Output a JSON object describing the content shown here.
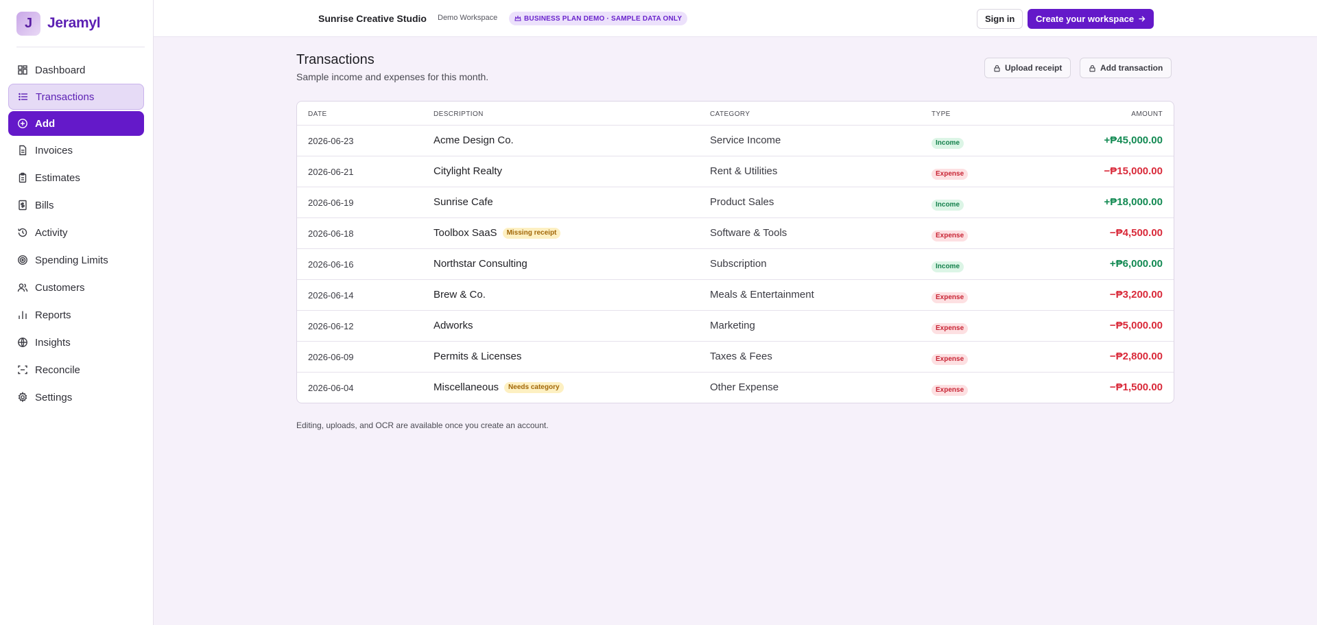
{
  "brand": {
    "logo_letter": "J",
    "name": "Jeramyl"
  },
  "sidebar": {
    "items": [
      {
        "label": "Dashboard",
        "icon": "grid-icon"
      },
      {
        "label": "Transactions",
        "icon": "list-icon",
        "active": true
      },
      {
        "label": "Add",
        "icon": "plus-circle-icon"
      },
      {
        "label": "Invoices",
        "icon": "file-text-icon"
      },
      {
        "label": "Estimates",
        "icon": "clipboard-icon"
      },
      {
        "label": "Bills",
        "icon": "bill-icon"
      },
      {
        "label": "Activity",
        "icon": "history-icon"
      },
      {
        "label": "Spending Limits",
        "icon": "target-icon"
      },
      {
        "label": "Customers",
        "icon": "users-icon"
      },
      {
        "label": "Reports",
        "icon": "bar-chart-icon"
      },
      {
        "label": "Insights",
        "icon": "globe-icon"
      },
      {
        "label": "Reconcile",
        "icon": "scan-icon"
      },
      {
        "label": "Settings",
        "icon": "gear-icon"
      }
    ]
  },
  "header": {
    "workspace_name": "Sunrise Creative Studio",
    "workspace_sub": "Demo Workspace",
    "plan_badge": "BUSINESS PLAN DEMO · SAMPLE DATA ONLY",
    "sign_in": "Sign in",
    "create_workspace": "Create your workspace"
  },
  "main": {
    "title": "Transactions",
    "subtitle": "Sample income and expenses for this month.",
    "upload_receipt": "Upload receipt",
    "add_transaction": "Add transaction",
    "footnote": "Editing, uploads, and OCR are available once you create an account."
  },
  "table": {
    "headers": {
      "date": "Date",
      "description": "Description",
      "category": "Category",
      "type": "Type",
      "amount": "Amount"
    },
    "rows": [
      {
        "date": "2026-06-23",
        "description": "Acme Design Co.",
        "tag": "",
        "category": "Service Income",
        "type": "Income",
        "amount": "+₱45,000.00"
      },
      {
        "date": "2026-06-21",
        "description": "Citylight Realty",
        "tag": "",
        "category": "Rent & Utilities",
        "type": "Expense",
        "amount": "−₱15,000.00"
      },
      {
        "date": "2026-06-19",
        "description": "Sunrise Cafe",
        "tag": "",
        "category": "Product Sales",
        "type": "Income",
        "amount": "+₱18,000.00"
      },
      {
        "date": "2026-06-18",
        "description": "Toolbox SaaS",
        "tag": "Missing receipt",
        "category": "Software & Tools",
        "type": "Expense",
        "amount": "−₱4,500.00"
      },
      {
        "date": "2026-06-16",
        "description": "Northstar Consulting",
        "tag": "",
        "category": "Subscription",
        "type": "Income",
        "amount": "+₱6,000.00"
      },
      {
        "date": "2026-06-14",
        "description": "Brew & Co.",
        "tag": "",
        "category": "Meals & Entertainment",
        "type": "Expense",
        "amount": "−₱3,200.00"
      },
      {
        "date": "2026-06-12",
        "description": "Adworks",
        "tag": "",
        "category": "Marketing",
        "type": "Expense",
        "amount": "−₱5,000.00"
      },
      {
        "date": "2026-06-09",
        "description": "Permits & Licenses",
        "tag": "",
        "category": "Taxes & Fees",
        "type": "Expense",
        "amount": "−₱2,800.00"
      },
      {
        "date": "2026-06-04",
        "description": "Miscellaneous",
        "tag": "Needs category",
        "category": "Other Expense",
        "type": "Expense",
        "amount": "−₱1,500.00"
      }
    ]
  },
  "colors": {
    "accent": "#6419c9",
    "income": "#138a53",
    "expense": "#d92a3a",
    "page_bg": "#f6f1fa"
  }
}
